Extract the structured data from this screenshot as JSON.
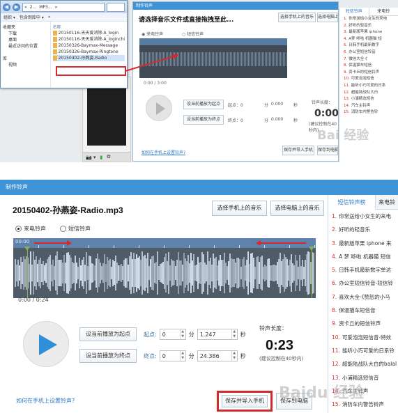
{
  "top": {
    "explorer": {
      "breadcrumb": [
        "«",
        "2...",
        "MP3...",
        "»"
      ],
      "toolbar": [
        "组织 ▾",
        "包含到库中 ▾",
        "»"
      ],
      "nav": [
        "收藏夹",
        "下载",
        "桌面",
        "最近访问的位置",
        "",
        "库",
        "视频"
      ],
      "files_header": "名称",
      "files": [
        "20150116-天天爱消除-A_login",
        "20150116-天天爱消除-A_loginchi",
        "20150326-Baymax-Message",
        "20150326-Baymax-Ringtone",
        "20150402-孙燕姿-Radio"
      ],
      "selected_index": 4
    },
    "phone_bar": [
      "📷 ▾",
      "▮",
      "⧉"
    ],
    "mini_app": {
      "titlebar": "制作铃声",
      "title": "请选择音乐文件或直接拖拽至此...",
      "btn_phone": "选择手机上的音乐",
      "btn_pc": "选择电脑上的音乐",
      "radio_ring": "来电铃声",
      "radio_sms": "短信铃声",
      "time": "0:00 / 3:00",
      "set_start": "设当前播放为起点",
      "set_end": "设当前播放为终点",
      "start_lbl": "起点：0",
      "end_lbl": "终点：0",
      "min": "分",
      "sec": "秒",
      "start_sec": "0.000",
      "end_sec": "0.000",
      "len_label": "铃声长度：",
      "len_value": "0:00",
      "len_hint": "(建议控制在40秒内)",
      "link": "如何在手机上设置铃声?",
      "save_phone": "保存并导入手机",
      "save_pc": "保存到电脑"
    },
    "mini_list": {
      "tab_on": "短信铃声",
      "tab_off": "来电铃",
      "items": [
        "你常送给小女生的来电",
        "好听的轻音乐",
        "最新版苹果 iphone",
        "A梦 哆啦 机器猫 短",
        "日韩手机最新数字",
        "办公室短信铃音",
        "微信大全·《",
        "保温猫车短信",
        "资卡丘的短信铃声",
        "可爱泡泡短信",
        "能听小巧可爱的日系",
        "超能陆战队大白",
        "小浦精选短信",
        "汽车主铃声",
        "消防车内警告铃"
      ]
    }
  },
  "app": {
    "titlebar": "制作铃声",
    "file_title": "20150402-孙燕姿-Radio.mp3",
    "btn_phone_music": "选择手机上的音乐",
    "btn_pc_music": "选择电脑上的音乐",
    "radio_ringtone": "来电铃声",
    "radio_sms": "短信铃声",
    "waveform_stamp": "00:00",
    "time_display": "0:00 / 0:24",
    "set_start_btn": "设当前播放为起点",
    "set_end_btn": "设当前播放为终点",
    "start_label": "起点:",
    "end_label": "终点:",
    "start_min": "0",
    "start_sec": "1.247",
    "end_min": "0",
    "end_sec": "24.386",
    "unit_min": "分",
    "unit_sec": "秒",
    "length_label": "铃声长度：",
    "length_value": "0:23",
    "length_hint": "(建议控制在40秒内)",
    "help_link": "如何在手机上设置铃声?",
    "save_to_phone": "保存并导入手机",
    "save_to_pc": "保存到电脑"
  },
  "ringtone_list": {
    "tab_sms": "短信铃声榜",
    "tab_call": "来电铃",
    "items": [
      {
        "n": "1.",
        "t": "你常送给小女生的来电"
      },
      {
        "n": "2.",
        "t": "好听的轻音乐"
      },
      {
        "n": "3.",
        "t": "最新版苹果 iphone 来"
      },
      {
        "n": "4.",
        "t": "A 梦 哆啦 机器猫 短信"
      },
      {
        "n": "5.",
        "t": "日韩手机最新数字单达"
      },
      {
        "n": "6.",
        "t": "办公室短信铃音-短信铃"
      },
      {
        "n": "7.",
        "t": "喜欢大全·《赞恕的小马"
      },
      {
        "n": "8.",
        "t": "保温猫车短信音"
      },
      {
        "n": "9.",
        "t": "资卡丘的短信铃声"
      },
      {
        "n": "10.",
        "t": "可爱泡泡短信音-特效"
      },
      {
        "n": "11.",
        "t": "能听小巧可爱的日系铃"
      },
      {
        "n": "12.",
        "t": "超能陆战队大白的balal"
      },
      {
        "n": "13.",
        "t": "小浦精选短信音"
      },
      {
        "n": "14.",
        "t": "汽车主铃声"
      },
      {
        "n": "15.",
        "t": "消防车内警告铃声"
      }
    ]
  },
  "watermarks": [
    "Baidu 经验",
    "Bai 经验"
  ]
}
